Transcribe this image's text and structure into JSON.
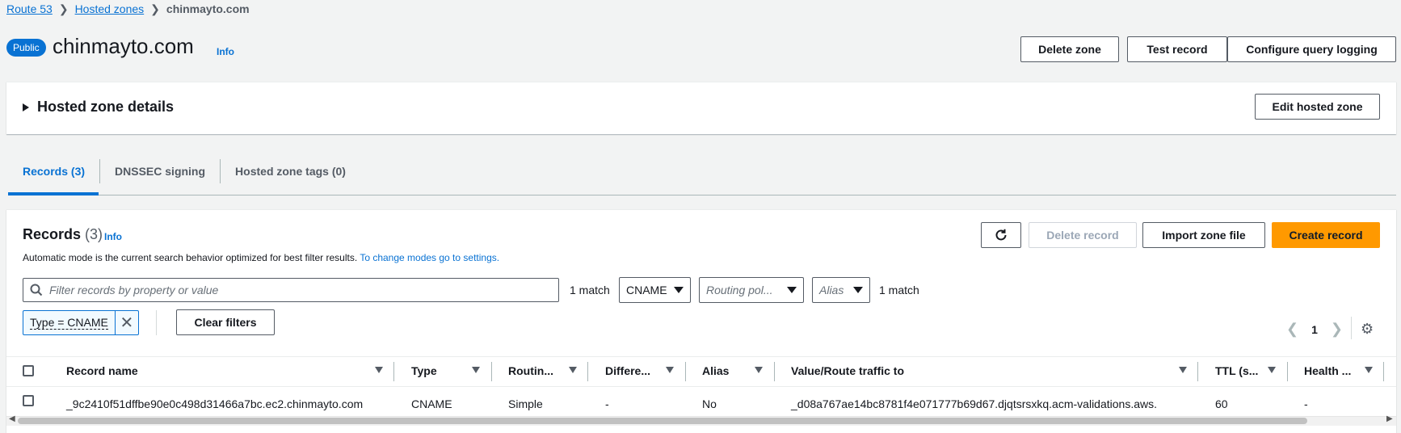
{
  "breadcrumb": {
    "items": [
      "Route 53",
      "Hosted zones"
    ],
    "current": "chinmayto.com"
  },
  "header": {
    "badge": "Public",
    "title": "chinmayto.com",
    "info": "Info",
    "buttons": {
      "delete_zone": "Delete zone",
      "test_record": "Test record",
      "configure_logging": "Configure query logging"
    }
  },
  "details": {
    "title": "Hosted zone details",
    "edit_button": "Edit hosted zone"
  },
  "tabs": [
    {
      "label": "Records (3)",
      "active": true
    },
    {
      "label": "DNSSEC signing",
      "active": false
    },
    {
      "label": "Hosted zone tags (0)",
      "active": false
    }
  ],
  "records": {
    "title": "Records",
    "count": "(3)",
    "info": "Info",
    "description": "Automatic mode is the current search behavior optimized for best filter results.",
    "settings_link": "To change modes go to settings.",
    "buttons": {
      "delete_record": "Delete record",
      "import_zone": "Import zone file",
      "create_record": "Create record"
    },
    "search": {
      "placeholder": "Filter records by property or value",
      "match": "1 match"
    },
    "filters": {
      "type": "CNAME",
      "routing": "Routing pol...",
      "alias": "Alias",
      "match": "1 match"
    },
    "token": "Type = CNAME",
    "clear_filters": "Clear filters",
    "page": "1",
    "columns": [
      "Record name",
      "Type",
      "Routin...",
      "Differe...",
      "Alias",
      "Value/Route traffic to",
      "TTL (s...",
      "Health ..."
    ],
    "rows": [
      {
        "name": "_9c2410f51dffbe90e0c498d31466a7bc.ec2.chinmayto.com",
        "type": "CNAME",
        "routing": "Simple",
        "differentiator": "-",
        "alias": "No",
        "value": "_d08a767ae14bc8781f4e071777b69d67.djqtsrsxkq.acm-validations.aws.",
        "ttl": "60",
        "health": "-"
      }
    ]
  }
}
